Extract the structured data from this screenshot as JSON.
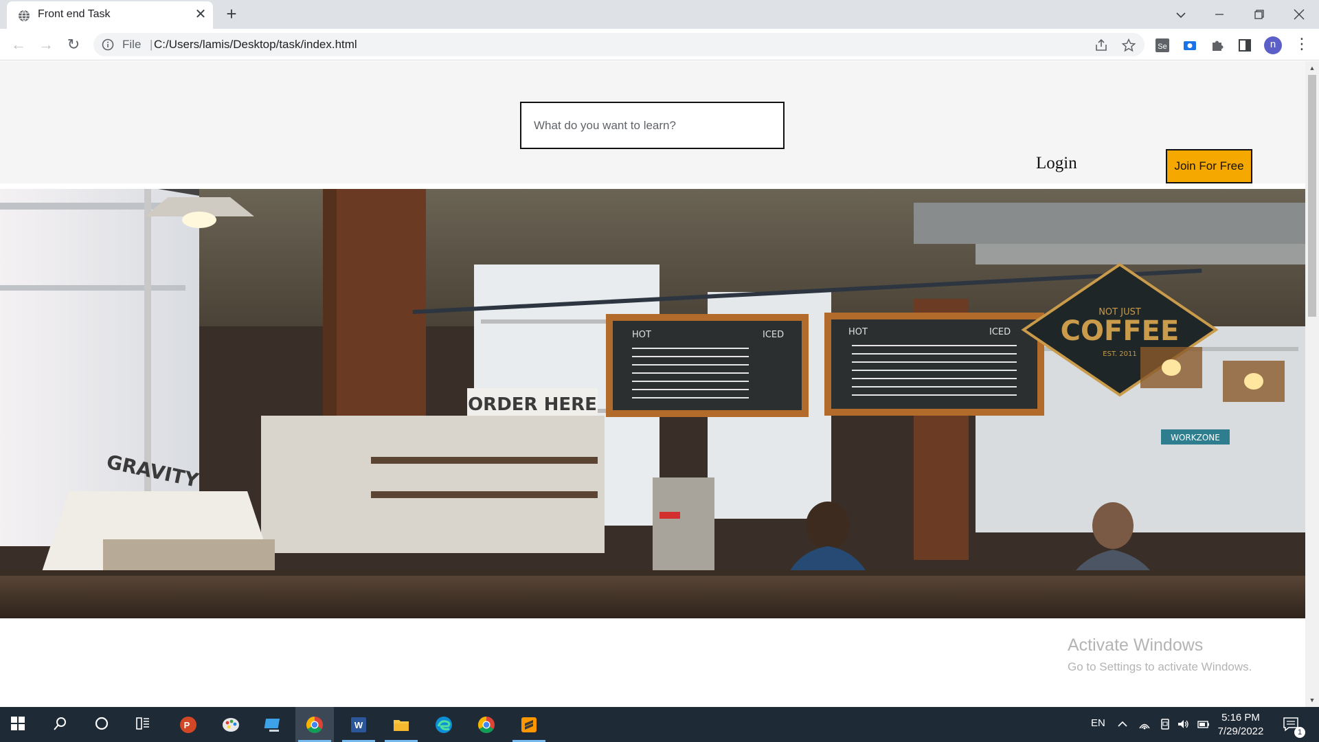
{
  "browser": {
    "tab": {
      "title": "Front end Task",
      "close_glyph": "✕",
      "favicon": "globe-icon"
    },
    "new_tab_glyph": "+",
    "window_controls": {
      "dropdown": "⌄",
      "minimize": "—",
      "restore": "❐",
      "close": "✕"
    },
    "nav": {
      "back": "←",
      "forward": "→",
      "reload": "↻"
    },
    "omnibox": {
      "scheme_label": "File",
      "separator": "|",
      "url": "C:/Users/lamis/Desktop/task/index.html"
    },
    "profile_initial": "n",
    "menu_glyph": "⋮"
  },
  "page": {
    "search": {
      "placeholder": "What do you want to learn?",
      "value": ""
    },
    "login_label": "Login",
    "join_label": "Join For Free",
    "join_color": "#f5a800",
    "hero_image": "coffee-shop-interior-photo",
    "hero_signs": {
      "order": "ORDER HERE",
      "brand_top": "NOT JUST",
      "brand_main": "COFFEE",
      "brand_est": "EST. 2011",
      "crate": "GRAVITY",
      "work": "WORKZONE",
      "menu_hot": "HOT",
      "menu_iced": "ICED"
    }
  },
  "watermark": {
    "title": "Activate Windows",
    "subtitle": "Go to Settings to activate Windows."
  },
  "taskbar": {
    "apps": [
      "windows-start",
      "search",
      "cortana",
      "task-view",
      "powerpoint",
      "paint",
      "desktop-app",
      "chrome",
      "word",
      "file-explorer",
      "edge",
      "chrome-alt",
      "sublime-text"
    ],
    "language": "EN",
    "time": "5:16 PM",
    "date": "7/29/2022",
    "notification_count": "1",
    "accent": "#76b9ed"
  }
}
